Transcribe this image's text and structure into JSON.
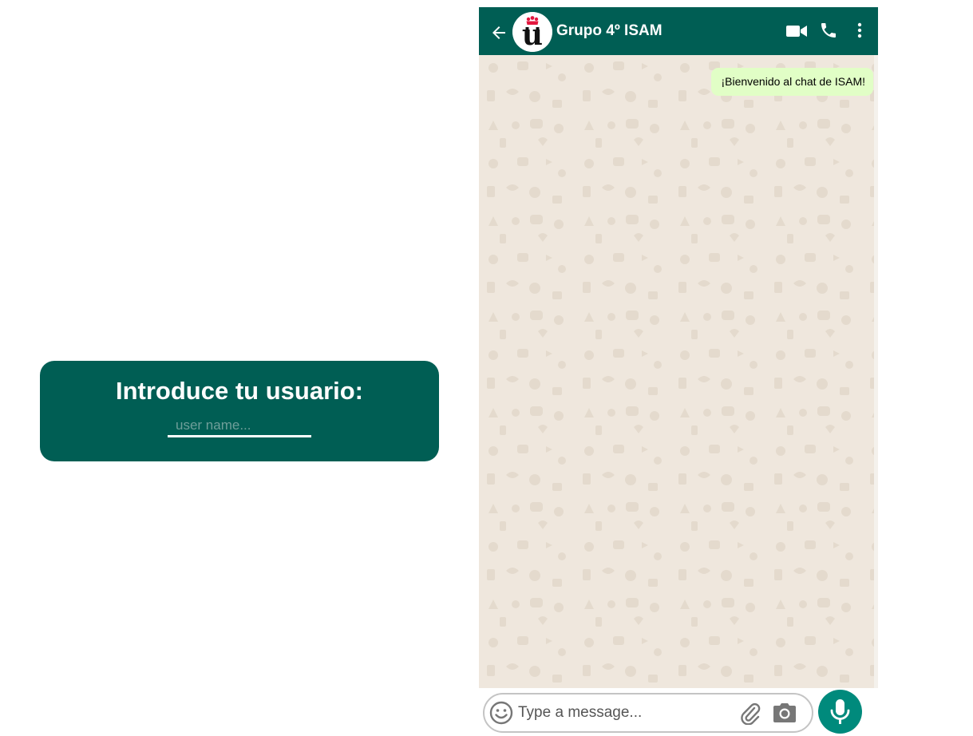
{
  "login": {
    "title": "Introduce tu usuario:",
    "placeholder": "user name..."
  },
  "chat": {
    "header": {
      "title": "Grupo 4º ISAM",
      "avatar_letter": "u",
      "icons": [
        "back-arrow-icon",
        "crown-icon",
        "video-call-icon",
        "phone-icon",
        "more-vertical-icon"
      ]
    },
    "messages": [
      {
        "text": "¡Bienvenido al chat de ISAM!",
        "outgoing": true
      }
    ],
    "composer": {
      "placeholder": "Type a message...",
      "icons": [
        "emoji-icon",
        "attach-icon",
        "camera-icon",
        "microphone-icon"
      ]
    }
  },
  "colors": {
    "primary": "#005e54",
    "mic_button": "#008a7c",
    "chat_background": "#efe7dd",
    "outgoing_bubble": "#e1fec6",
    "crown": "#e3173e"
  }
}
